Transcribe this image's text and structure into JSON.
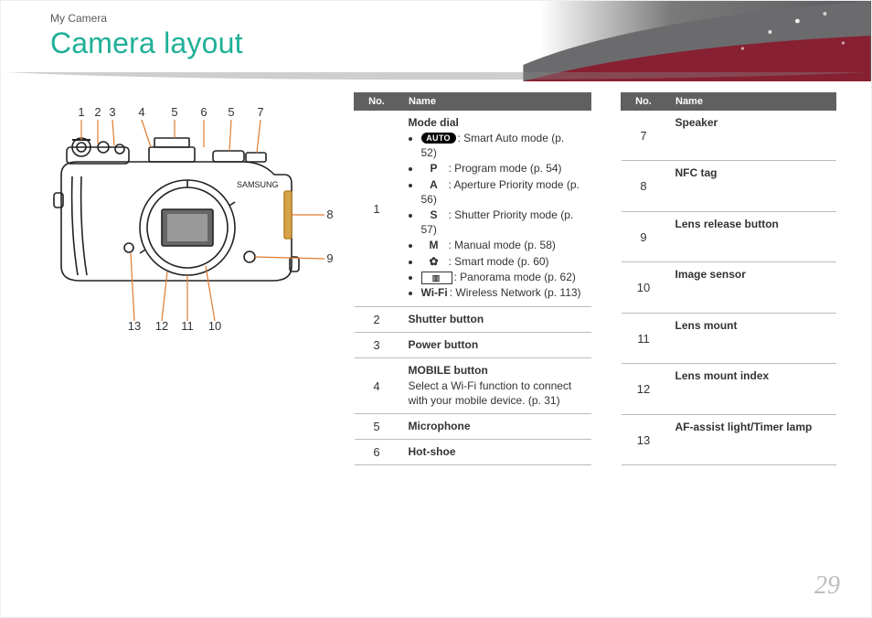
{
  "chapter": "My Camera",
  "title": "Camera layout",
  "page_number": "29",
  "table_headers": {
    "no": "No.",
    "name": "Name"
  },
  "callouts_top": [
    "1",
    "2",
    "3",
    "4",
    "5",
    "6",
    "5",
    "7"
  ],
  "callouts_right": [
    "8",
    "9"
  ],
  "callouts_bottom": [
    "13",
    "12",
    "11",
    "10"
  ],
  "table1": [
    {
      "no": "1",
      "title": "Mode dial",
      "modes": [
        {
          "icon_name": "auto-icon",
          "icon_text": "AUTO",
          "icon_class": "auto",
          "label": "Smart Auto mode (p. 52)"
        },
        {
          "icon_name": "program-icon",
          "icon_text": "P",
          "icon_class": "",
          "label": "Program mode (p. 54)"
        },
        {
          "icon_name": "aperture-icon",
          "icon_text": "A",
          "icon_class": "",
          "label": "Aperture Priority mode (p. 56)"
        },
        {
          "icon_name": "shutter-icon",
          "icon_text": "S",
          "icon_class": "",
          "label": "Shutter Priority mode (p. 57)"
        },
        {
          "icon_name": "manual-icon",
          "icon_text": "M",
          "icon_class": "",
          "label": "Manual mode (p. 58)"
        },
        {
          "icon_name": "smart-icon",
          "icon_text": "✿",
          "icon_class": "gear",
          "label": "Smart mode (p. 60)"
        },
        {
          "icon_name": "panorama-icon",
          "icon_text": "▥",
          "icon_class": "pano",
          "label": "Panorama mode (p. 62)"
        },
        {
          "icon_name": "wifi-icon",
          "icon_text": "Wi-Fi",
          "icon_class": "",
          "label": "Wireless Network (p. 113)"
        }
      ]
    },
    {
      "no": "2",
      "title": "Shutter button"
    },
    {
      "no": "3",
      "title": "Power button"
    },
    {
      "no": "4",
      "title": "MOBILE button",
      "sub": "Select a Wi-Fi function to connect with your mobile device. (p. 31)"
    },
    {
      "no": "5",
      "title": "Microphone"
    },
    {
      "no": "6",
      "title": "Hot-shoe"
    }
  ],
  "table2": [
    {
      "no": "7",
      "title": "Speaker"
    },
    {
      "no": "8",
      "title": "NFC tag"
    },
    {
      "no": "9",
      "title": "Lens release button"
    },
    {
      "no": "10",
      "title": "Image sensor"
    },
    {
      "no": "11",
      "title": "Lens mount"
    },
    {
      "no": "12",
      "title": "Lens mount index"
    },
    {
      "no": "13",
      "title": "AF-assist light/Timer lamp"
    }
  ]
}
